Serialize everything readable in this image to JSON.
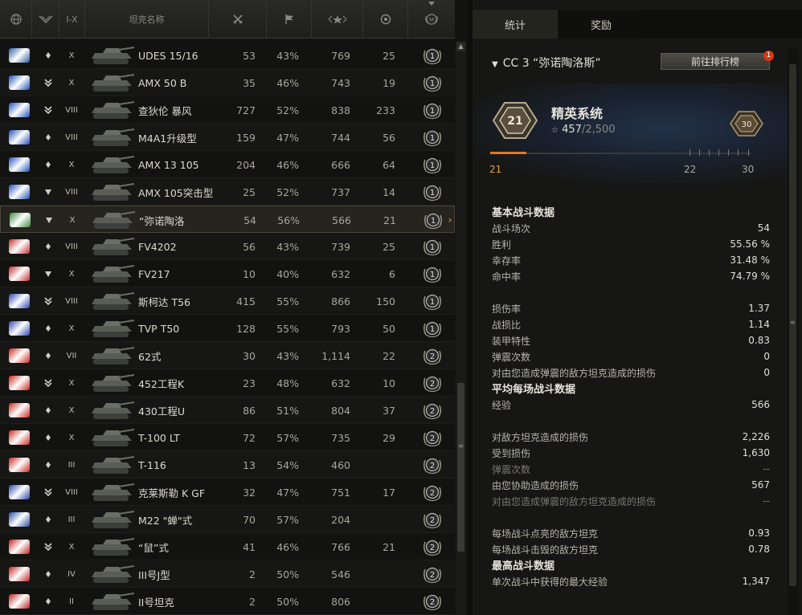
{
  "tabs": {
    "stats": "统计",
    "awards": "奖励"
  },
  "header": {
    "tier_label": "I-X",
    "name_label": "坦克名称"
  },
  "tanks": [
    {
      "name": "UDES 15/16",
      "tier": "X",
      "battles": "53",
      "win": "43%",
      "xp": "769",
      "kills": "25",
      "mastery": "1",
      "flag": "#2a5ca0",
      "rank_icon": "chevron-single"
    },
    {
      "name": "AMX 50 B",
      "tier": "X",
      "battles": "35",
      "win": "46%",
      "xp": "743",
      "kills": "19",
      "mastery": "1",
      "flag": "#2050b8",
      "rank_icon": "chevron-double"
    },
    {
      "name": "查狄伦 暴风",
      "tier": "VIII",
      "battles": "727",
      "win": "52%",
      "xp": "838",
      "kills": "233",
      "mastery": "1",
      "flag": "#2050b8",
      "rank_icon": "chevron-double"
    },
    {
      "name": "M4A1升级型",
      "tier": "VIII",
      "battles": "159",
      "win": "47%",
      "xp": "744",
      "kills": "56",
      "mastery": "1",
      "flag": "#2050b8",
      "rank_icon": "chevron-single"
    },
    {
      "name": "AMX 13 105",
      "tier": "X",
      "battles": "204",
      "win": "46%",
      "xp": "666",
      "kills": "64",
      "mastery": "1",
      "flag": "#2050b8",
      "rank_icon": "chevron-single"
    },
    {
      "name": "AMX 105突击型",
      "tier": "VIII",
      "battles": "25",
      "win": "52%",
      "xp": "737",
      "kills": "14",
      "mastery": "1",
      "flag": "#2050b8",
      "rank_icon": "triangle"
    },
    {
      "name": "“弥诺陶洛",
      "tier": "X",
      "battles": "54",
      "win": "56%",
      "xp": "566",
      "kills": "21",
      "mastery": "1",
      "flag": "#3a8a3a",
      "rank_icon": "triangle",
      "selected": true
    },
    {
      "name": "FV4202",
      "tier": "VIII",
      "battles": "56",
      "win": "43%",
      "xp": "739",
      "kills": "25",
      "mastery": "1",
      "flag": "#c03030",
      "rank_icon": "chevron-single"
    },
    {
      "name": "FV217",
      "tier": "X",
      "battles": "10",
      "win": "40%",
      "xp": "632",
      "kills": "6",
      "mastery": "1",
      "flag": "#c03030",
      "rank_icon": "triangle"
    },
    {
      "name": "斯柯达 T56",
      "tier": "VIII",
      "battles": "415",
      "win": "55%",
      "xp": "866",
      "kills": "150",
      "mastery": "1",
      "flag": "#2a48b0",
      "rank_icon": "chevron-double"
    },
    {
      "name": "TVP T50",
      "tier": "X",
      "battles": "128",
      "win": "55%",
      "xp": "793",
      "kills": "50",
      "mastery": "1",
      "flag": "#2a48b0",
      "rank_icon": "chevron-single"
    },
    {
      "name": "62式",
      "tier": "VII",
      "battles": "30",
      "win": "43%",
      "xp": "1,114",
      "kills": "22",
      "mastery": "2",
      "flag": "#c8281e",
      "rank_icon": "chevron-single"
    },
    {
      "name": "452工程K",
      "tier": "X",
      "battles": "23",
      "win": "48%",
      "xp": "632",
      "kills": "10",
      "mastery": "2",
      "flag": "#c8281e",
      "rank_icon": "chevron-double"
    },
    {
      "name": "430工程U",
      "tier": "X",
      "battles": "86",
      "win": "51%",
      "xp": "804",
      "kills": "37",
      "mastery": "2",
      "flag": "#c8281e",
      "rank_icon": "chevron-single"
    },
    {
      "name": "T-100 LT",
      "tier": "X",
      "battles": "72",
      "win": "57%",
      "xp": "735",
      "kills": "29",
      "mastery": "2",
      "flag": "#c8281e",
      "rank_icon": "chevron-single"
    },
    {
      "name": "T-116",
      "tier": "III",
      "battles": "13",
      "win": "54%",
      "xp": "460",
      "kills": "",
      "mastery": "2",
      "flag": "#c8281e",
      "rank_icon": "chevron-single"
    },
    {
      "name": "克莱斯勒 K GF",
      "tier": "VIII",
      "battles": "32",
      "win": "47%",
      "xp": "751",
      "kills": "17",
      "mastery": "2",
      "flag": "#2848a8",
      "rank_icon": "chevron-double"
    },
    {
      "name": "M22 \"蝉\"式",
      "tier": "III",
      "battles": "70",
      "win": "57%",
      "xp": "204",
      "kills": "",
      "mastery": "2",
      "flag": "#2848a8",
      "rank_icon": "chevron-single"
    },
    {
      "name": "“鼠”式",
      "tier": "X",
      "battles": "41",
      "win": "46%",
      "xp": "766",
      "kills": "21",
      "mastery": "2",
      "flag": "#c02020",
      "rank_icon": "chevron-double"
    },
    {
      "name": "III号J型",
      "tier": "IV",
      "battles": "2",
      "win": "50%",
      "xp": "546",
      "kills": "",
      "mastery": "2",
      "flag": "#c02020",
      "rank_icon": "chevron-single"
    },
    {
      "name": "II号坦克",
      "tier": "II",
      "battles": "2",
      "win": "50%",
      "xp": "806",
      "kills": "",
      "mastery": "2",
      "flag": "#c02020",
      "rank_icon": "chevron-single"
    }
  ],
  "detail": {
    "title": "CC 3 “弥诺陶洛斯”",
    "leaderboard_btn": "前往排行榜",
    "notif_count": "1",
    "elite": {
      "title": "精英系统",
      "level": "21",
      "next_badge": "30",
      "progress_current": "457",
      "progress_total": "/2,500",
      "progress_fraction": 0.18,
      "scale_left": "21",
      "scale_mid": "22",
      "scale_right": "30"
    },
    "sections": [
      {
        "heading": "基本战斗数据",
        "rows": [
          {
            "label": "战斗场次",
            "value": "54"
          },
          {
            "label": "胜利",
            "value": "55.56 %"
          },
          {
            "label": "幸存率",
            "value": "31.48 %"
          },
          {
            "label": "命中率",
            "value": "74.79 %"
          }
        ]
      },
      {
        "heading": "",
        "rows": [
          {
            "label": "损伤率",
            "value": "1.37"
          },
          {
            "label": "战损比",
            "value": "1.14"
          },
          {
            "label": "装甲特性",
            "value": "0.83"
          },
          {
            "label": "弹震次数",
            "value": "0"
          },
          {
            "label": "对由您造成弹震的敌方坦克造成的损伤",
            "value": "0"
          }
        ]
      },
      {
        "heading": "平均每场战斗数据",
        "rows": [
          {
            "label": "经验",
            "value": "566"
          }
        ]
      },
      {
        "heading": "",
        "rows": [
          {
            "label": "对敌方坦克造成的损伤",
            "value": "2,226"
          },
          {
            "label": "受到损伤",
            "value": "1,630"
          },
          {
            "label": "弹震次数",
            "value": "--",
            "dim": true
          },
          {
            "label": "由您协助造成的损伤",
            "value": "567"
          },
          {
            "label": "对由您造成弹震的敌方坦克造成的损伤",
            "value": "--",
            "dim": true
          }
        ]
      },
      {
        "heading": "",
        "rows": [
          {
            "label": "每场战斗点亮的敌方坦克",
            "value": "0.93"
          },
          {
            "label": "每场战斗击毁的敌方坦克",
            "value": "0.78"
          }
        ]
      },
      {
        "heading": "最高战斗数据",
        "rows": [
          {
            "label": "单次战斗中获得的最大经验",
            "value": "1,347"
          }
        ]
      }
    ]
  }
}
